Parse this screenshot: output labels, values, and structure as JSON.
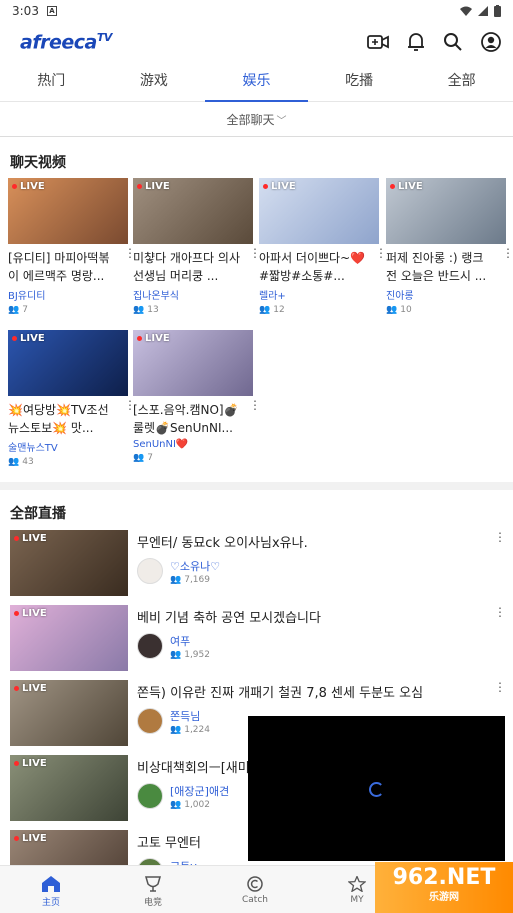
{
  "status": {
    "time": "3:03",
    "badge": "A"
  },
  "app": {
    "logo": "afreeca",
    "logo_sup": "TV"
  },
  "tabs": [
    "热门",
    "游戏",
    "娱乐",
    "吃播",
    "全部"
  ],
  "active_tab_index": 2,
  "filter": {
    "label": "全部聊天"
  },
  "sections": {
    "chat_videos": "聊天视频",
    "all_live": "全部直播"
  },
  "live_label": "LIVE",
  "chat_cards": [
    {
      "title": "[유디티] 마피아떡볶이 에르맥주 명랑...",
      "name": "BJ유디티",
      "viewers": "7",
      "thumb_color": "#c77b4c"
    },
    {
      "title": "미챻다 개아프다 의사선생님 머리쿵 ...",
      "name": "집나온부식",
      "viewers": "13",
      "thumb_color": "#8a7a6a"
    },
    {
      "title": "아파서 더이쁘다~❤️ #짧방#소통#...",
      "name": "렐라+",
      "viewers": "12",
      "thumb_color": "#b8c7e0"
    },
    {
      "title": "퍼제 진아롱 :) 랭크전 오늘은 반드시 ...",
      "name": "진아롱",
      "viewers": "10",
      "thumb_color": "#9fa8b5"
    },
    {
      "title": "💥여당방💥TV조선뉴스토보💥 맛...",
      "name": "술맨뉴스TV",
      "viewers": "43",
      "thumb_color": "#1e3f8a"
    },
    {
      "title": "[스포.음악.캠NO]💣룰렛💣SenUnNI...",
      "name": "SenUnNI❤️",
      "viewers": "7",
      "thumb_color": "#a8a0c8"
    }
  ],
  "live_rows": [
    {
      "title": "무엔터/ 동묘ck 오이사님x유나.",
      "name": "♡소유나♡",
      "viewers": "7,169",
      "thumb_color": "#5a4a3a"
    },
    {
      "title": "베비 기념 축하 공연 모시겠습니다",
      "name": "여푸",
      "viewers": "1,952",
      "thumb_color": "#c8a0c0"
    },
    {
      "title": "쫀득) 이유란 진짜 개패기 철권 7,8 센세 두분도 오심",
      "name": "쫀득님",
      "viewers": "1,224",
      "thumb_color": "#8a8070"
    },
    {
      "title": "비상대책회의ㅡ[새미",
      "name": "[애장군]애견",
      "viewers": "1,002",
      "thumb_color": "#6a7060"
    },
    {
      "title": "고토 무엔터",
      "name": "고토v",
      "viewers": "",
      "thumb_color": "#7a6a5a"
    }
  ],
  "bottom_nav": [
    {
      "label": "主页",
      "icon": "home-icon"
    },
    {
      "label": "电竞",
      "icon": "trophy-icon"
    },
    {
      "label": "Catch",
      "icon": "catch-icon"
    },
    {
      "label": "MY",
      "icon": "star-icon"
    }
  ],
  "watermark": {
    "text": "962.NET",
    "sub": "乐游网"
  },
  "colors": {
    "accent": "#2f5fd6",
    "live_dot": "#ff2a2a",
    "logo": "#1a47b8"
  }
}
